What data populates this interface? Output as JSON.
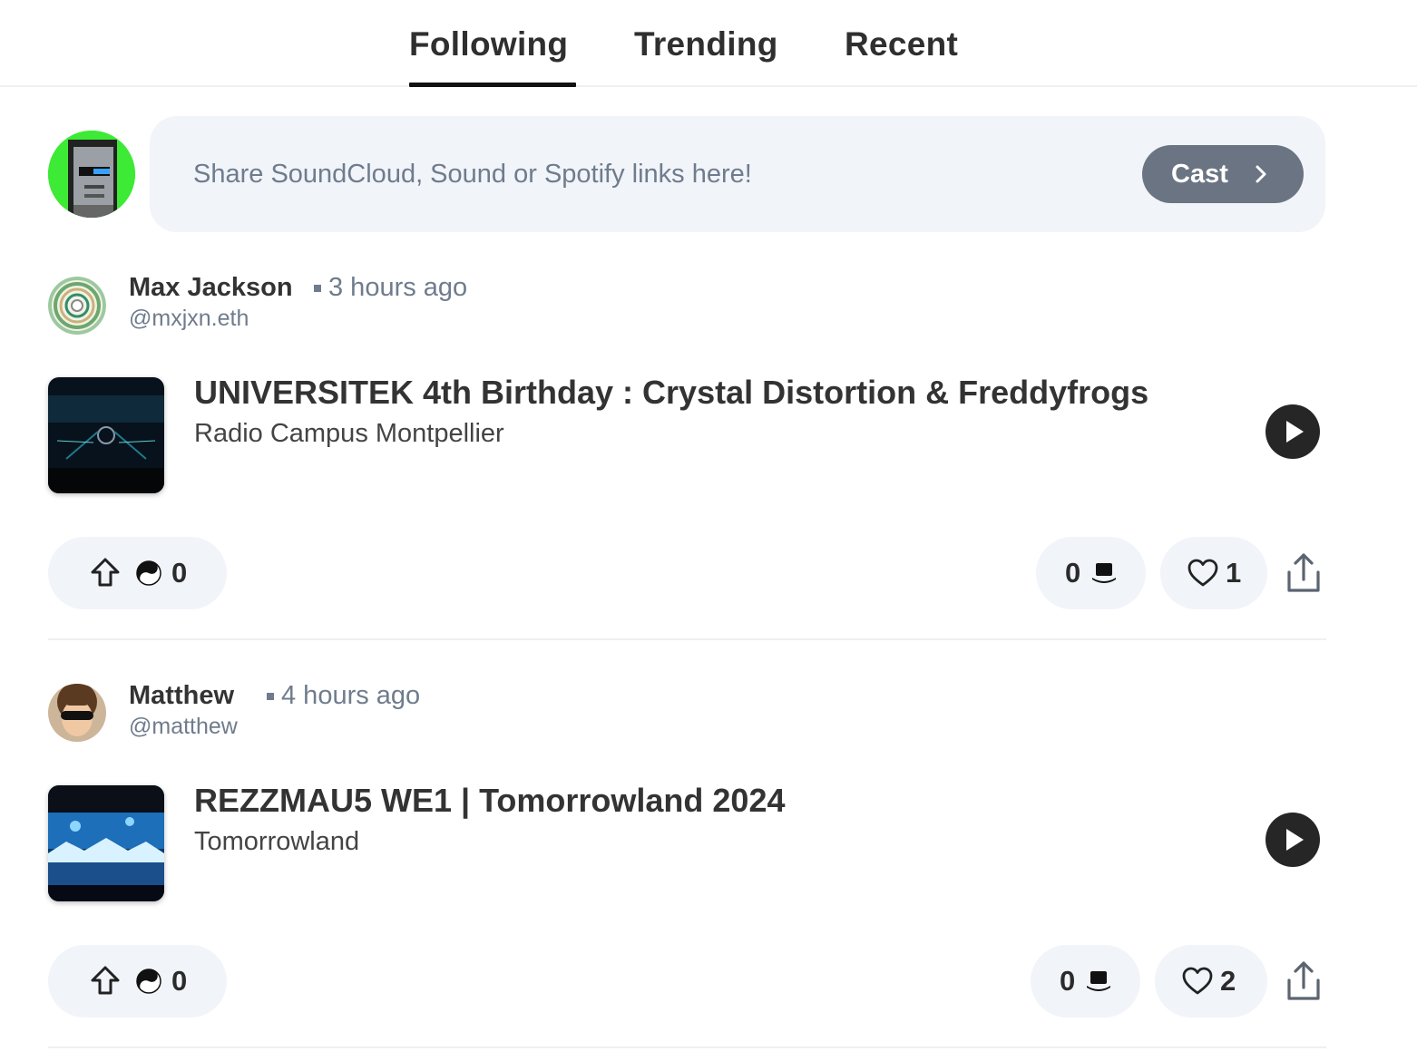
{
  "tabs": [
    {
      "label": "Following",
      "active": true
    },
    {
      "label": "Trending",
      "active": false
    },
    {
      "label": "Recent",
      "active": false
    }
  ],
  "composer": {
    "placeholder": "Share SoundCloud, Sound or Spotify links here!",
    "cast_label": "Cast"
  },
  "posts": [
    {
      "author": "Max Jackson",
      "time": "3 hours ago",
      "handle": "@mxjxn.eth",
      "track_title": "UNIVERSITEK 4th Birthday : Crystal Distortion & Freddyfrogs",
      "track_artist": "Radio Campus Montpellier",
      "upvotes": "0",
      "hats": "0",
      "likes": "1"
    },
    {
      "author": "Matthew",
      "time": "4 hours ago",
      "handle": "@matthew",
      "track_title": "REZZMAU5 WE1 | Tomorrowland 2024",
      "track_artist": "Tomorrowland",
      "upvotes": "0",
      "hats": "0",
      "likes": "2"
    }
  ],
  "icons": {
    "upvote": "upvote-arrow-icon",
    "token": "yin-yang-icon",
    "hat": "top-hat-icon",
    "like": "heart-icon",
    "share": "share-icon",
    "play": "play-icon",
    "chevron": "chevron-right-icon"
  },
  "colors": {
    "accent_dark": "#262626",
    "pill_bg": "#f1f4f9",
    "muted_text": "#6f7c8d",
    "cast_button": "#6b7482"
  }
}
